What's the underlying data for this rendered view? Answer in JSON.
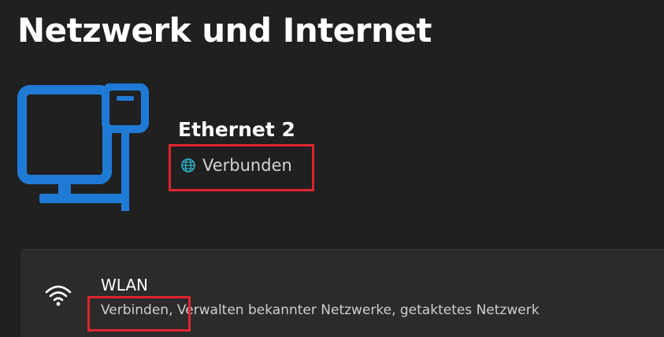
{
  "page": {
    "title": "Netzwerk und Internet"
  },
  "device": {
    "name": "Ethernet 2",
    "status": "Verbunden",
    "icon": "ethernet-computer-icon",
    "status_icon": "globe-icon",
    "accent_color": "#1f7ad6"
  },
  "wlan": {
    "title": "WLAN",
    "description": "Verbinden, Verwalten bekannter Netzwerke, getaktetes Netzwerk",
    "icon": "wifi-icon"
  },
  "colors": {
    "background": "#202020",
    "card": "#2b2b2b",
    "highlight": "#e0242e"
  }
}
